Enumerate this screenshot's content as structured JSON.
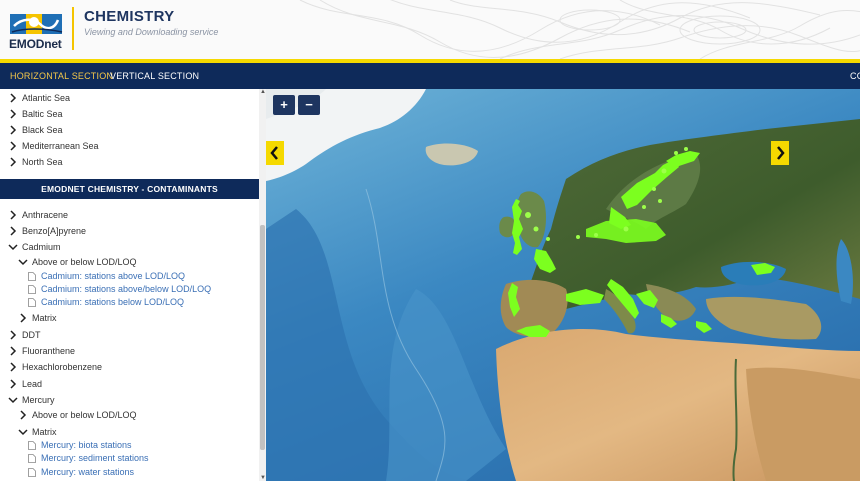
{
  "header": {
    "logo_text": "EMODnet",
    "title": "CHEMISTRY",
    "subtitle": "Viewing and Downloading service"
  },
  "nav": {
    "items": [
      {
        "label": "HORIZONTAL SECTION",
        "active": true
      },
      {
        "label": "VERTICAL SECTION",
        "active": false
      },
      {
        "label": "CO",
        "active": false
      }
    ]
  },
  "sidebar": {
    "regions": [
      {
        "label": "Atlantic Sea",
        "expanded": false
      },
      {
        "label": "Baltic Sea",
        "expanded": false
      },
      {
        "label": "Black Sea",
        "expanded": false
      },
      {
        "label": "Mediterranean Sea",
        "expanded": false
      },
      {
        "label": "North Sea",
        "expanded": false
      }
    ],
    "section_header": "EMODNET CHEMISTRY - CONTAMINANTS",
    "contaminants": {
      "anthracene": "Anthracene",
      "benzo": "Benzo[A]pyrene",
      "cadmium": "Cadmium",
      "cadmium_lod": "Above or below LOD/LOQ",
      "cadmium_layer_1": "Cadmium: stations above LOD/LOQ",
      "cadmium_layer_2": "Cadmium: stations above/below LOD/LOQ",
      "cadmium_layer_3": "Cadmium: stations below LOD/LOQ",
      "cadmium_matrix": "Matrix",
      "ddt": "DDT",
      "fluoranthene": "Fluoranthene",
      "hexachlorobenzene": "Hexachlorobenzene",
      "lead": "Lead",
      "mercury": "Mercury",
      "mercury_lod": "Above or below LOD/LOQ",
      "mercury_matrix": "Matrix",
      "mercury_layer_1": "Mercury: biota stations",
      "mercury_layer_2": "Mercury: sediment stations",
      "mercury_layer_3": "Mercury: water stations"
    }
  },
  "map": {
    "zoom_in": "+",
    "zoom_out": "−"
  },
  "colors": {
    "navy": "#0e2a5a",
    "accent_yellow": "#f5d900",
    "link_blue": "#3a6fb5",
    "station_green": "#7cff1f"
  }
}
